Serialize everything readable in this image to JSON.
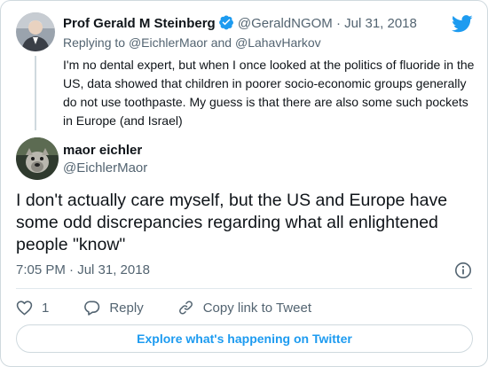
{
  "parent": {
    "author_name": "Prof Gerald M Steinberg",
    "handle": "@GeraldNGOM",
    "separator": "·",
    "date": "Jul 31, 2018",
    "replying_prefix": "Replying to",
    "reply_user_1": "@EichlerMaor",
    "reply_and": "and",
    "reply_user_2": "@LahavHarkov",
    "text": "I'm no dental expert, but when I once looked at the politics of fluoride in the US, data showed that children in poorer socio-economic groups generally do not use toothpaste. My guess is that there are also some such pockets in Europe (and Israel)"
  },
  "tweet": {
    "author_name": "maor eichler",
    "handle": "@EichlerMaor",
    "text": "I don't actually care myself, but the US and Europe have some odd discrepancies regarding what all enlightened people \"know\"",
    "timestamp": "7:05 PM · Jul 31, 2018"
  },
  "actions": {
    "like_count": "1",
    "reply_label": "Reply",
    "copy_label": "Copy link to Tweet"
  },
  "explore_label": "Explore what's happening on Twitter",
  "colors": {
    "accent": "#1d9bf0",
    "text": "#0f1419",
    "secondary": "#536471",
    "border": "#cfd9de"
  },
  "icons": {
    "logo": "twitter-bird-icon",
    "verified": "verified-badge-icon",
    "info": "info-icon",
    "like": "heart-icon",
    "reply": "reply-bubble-icon",
    "copy": "link-icon"
  }
}
